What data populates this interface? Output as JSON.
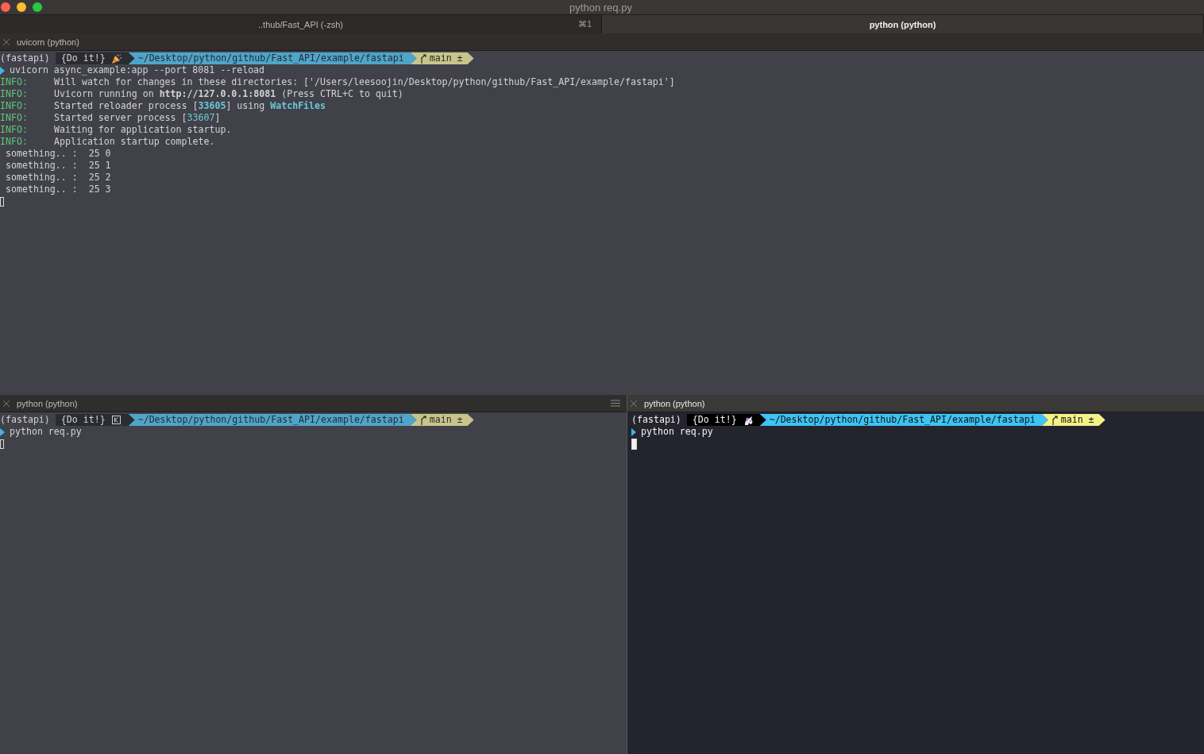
{
  "window": {
    "title": "python req.py"
  },
  "tabs": [
    {
      "label": "..thub/Fast_API (-zsh)",
      "shortcut": "⌘1",
      "selected": false
    },
    {
      "label": "python (python)",
      "selected": true
    }
  ],
  "panes": [
    {
      "title": "uvicorn (python)",
      "active": false,
      "menu": false,
      "prompt": {
        "env": "(fastapi)",
        "badge": "{Do it!}",
        "path": "~/Desktop/python/github/Fast_API/example/fastapi",
        "branch": "main ±"
      },
      "command": "uvicorn async_example:app --port 8081 --reload",
      "lines": [
        {
          "kind": "log",
          "level": "INFO:",
          "segments": [
            {
              "text": "Will watch for changes in these directories: ['/Users/leesoojin/Desktop/python/github/Fast_API/example/fastapi']",
              "kind": "text"
            }
          ]
        },
        {
          "kind": "log",
          "level": "INFO:",
          "segments": [
            {
              "text": "Uvicorn running on ",
              "kind": "text"
            },
            {
              "text": "http://127.0.0.1:8081",
              "kind": "strong"
            },
            {
              "text": " (Press CTRL+C to quit)",
              "kind": "text"
            }
          ]
        },
        {
          "kind": "log",
          "level": "INFO:",
          "segments": [
            {
              "text": "Started reloader process [",
              "kind": "text"
            },
            {
              "text": "33605",
              "kind": "strong-number"
            },
            {
              "text": "] using ",
              "kind": "text"
            },
            {
              "text": "WatchFiles",
              "kind": "strong-number"
            }
          ]
        },
        {
          "kind": "log",
          "level": "INFO:",
          "segments": [
            {
              "text": "Started server process [",
              "kind": "text"
            },
            {
              "text": "33607",
              "kind": "number"
            },
            {
              "text": "]",
              "kind": "text"
            }
          ]
        },
        {
          "kind": "log",
          "level": "INFO:",
          "segments": [
            {
              "text": "Waiting for application startup.",
              "kind": "text"
            }
          ]
        },
        {
          "kind": "log",
          "level": "INFO:",
          "segments": [
            {
              "text": "Application startup complete.",
              "kind": "text"
            }
          ]
        },
        {
          "kind": "plain",
          "segments": [
            {
              "text": " something.. :  25 0",
              "kind": "text"
            }
          ]
        },
        {
          "kind": "plain",
          "segments": [
            {
              "text": " something.. :  25 1",
              "kind": "text"
            }
          ]
        },
        {
          "kind": "plain",
          "segments": [
            {
              "text": " something.. :  25 2",
              "kind": "text"
            }
          ]
        },
        {
          "kind": "plain",
          "segments": [
            {
              "text": " something.. :  25 3",
              "kind": "text"
            }
          ]
        }
      ]
    },
    {
      "title": "python (python)",
      "active": false,
      "menu": true,
      "prompt": {
        "env": "(fastapi)",
        "badge": "{Do it!}",
        "path": "~/Desktop/python/github/Fast_API/example/fastapi",
        "branch": "main ±"
      },
      "command": "python req.py"
    },
    {
      "title": "python (python)",
      "active": true,
      "menu": false,
      "prompt": {
        "env": "(fastapi)",
        "badge": "{Do it!}",
        "path": "~/Desktop/python/github/Fast_API/example/fastapi",
        "branch": "main ±"
      },
      "command": "python req.py"
    }
  ]
}
